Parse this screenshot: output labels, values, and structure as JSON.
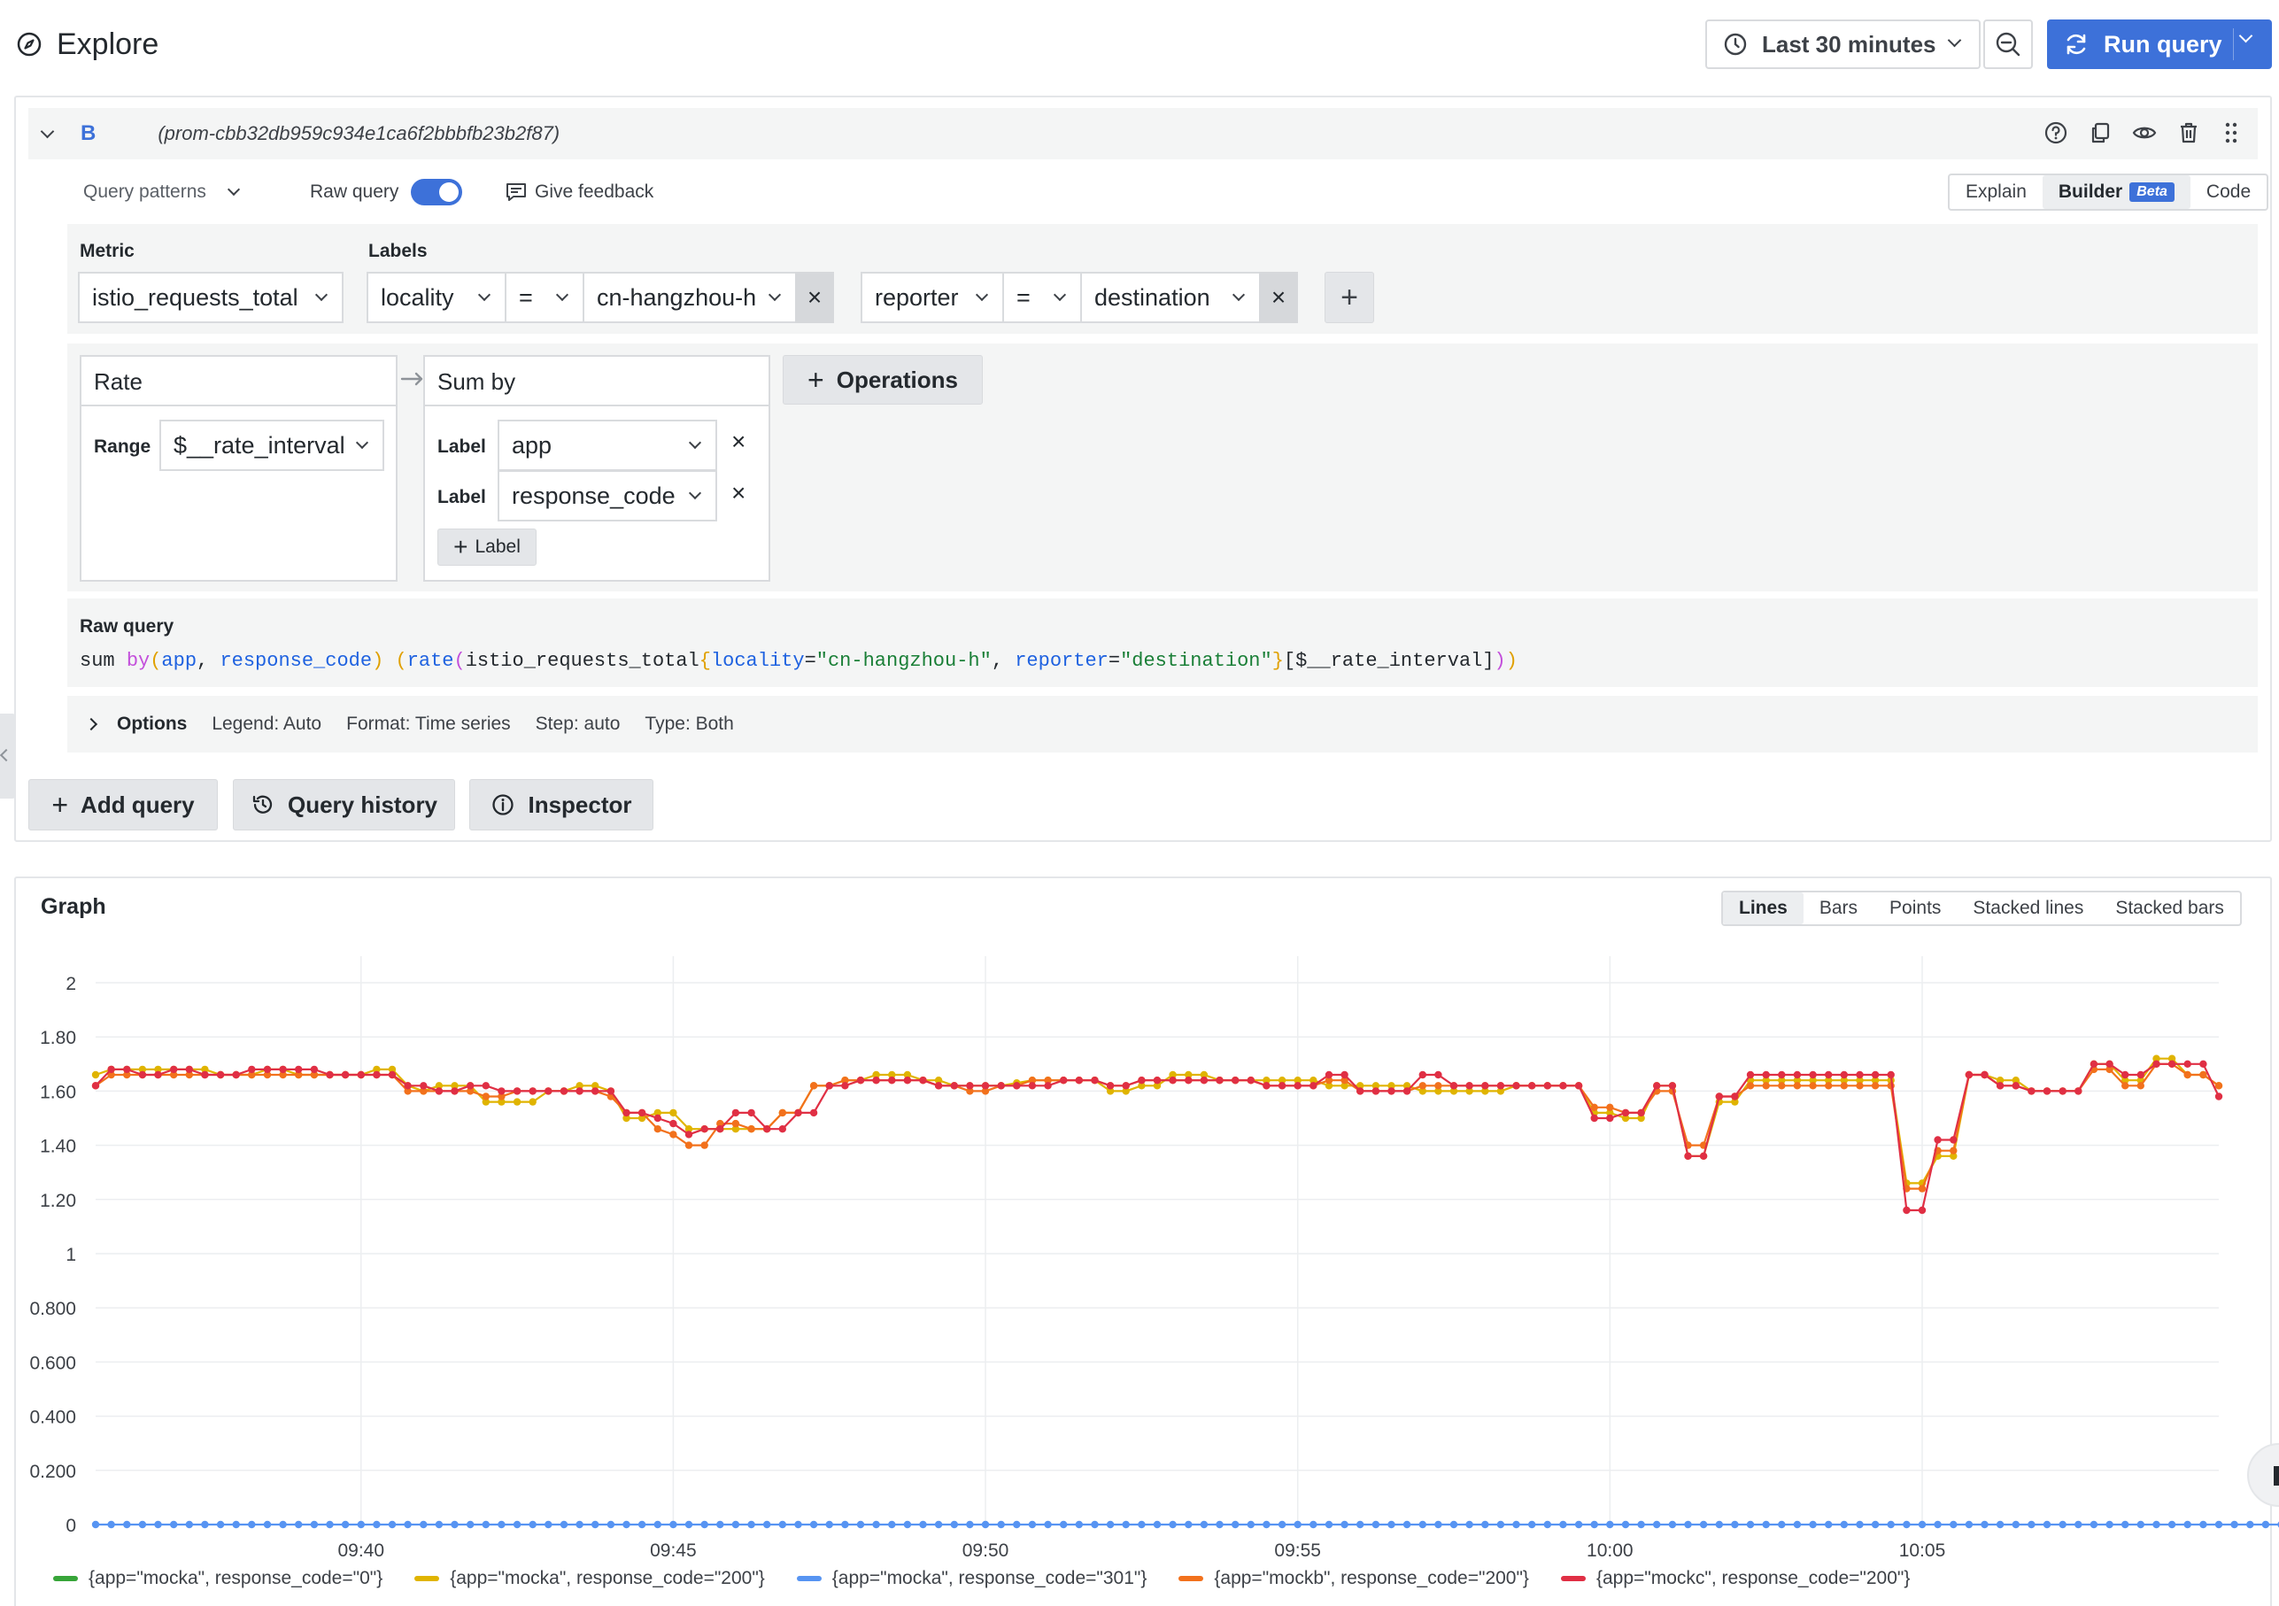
{
  "header": {
    "title": "Explore",
    "time_range": "Last 30 minutes",
    "run_query_label": "Run query"
  },
  "query": {
    "letter": "B",
    "datasource_id": "(prom-cbb32db959c934e1ca6f2bbbfb23b2f87)",
    "patterns_label": "Query patterns",
    "raw_query_toggle_label": "Raw query",
    "raw_query_toggle_on": true,
    "feedback_label": "Give feedback",
    "modes": [
      "Explain",
      "Builder",
      "Code"
    ],
    "active_mode": "Builder",
    "beta_badge": "Beta",
    "metric_label": "Metric",
    "metric_value": "istio_requests_total",
    "labels_label": "Labels",
    "label_filters": [
      {
        "key": "locality",
        "op": "=",
        "value": "cn-hangzhou-h"
      },
      {
        "key": "reporter",
        "op": "=",
        "value": "destination"
      }
    ],
    "ops": {
      "rate_title": "Rate",
      "range_label": "Range",
      "range_value": "$__rate_interval",
      "sumby_title": "Sum by",
      "label_word": "Label",
      "sumby_labels": [
        "app",
        "response_code"
      ],
      "add_label": "Label",
      "operations_button": "Operations"
    },
    "raw": {
      "title": "Raw query",
      "tokens": [
        {
          "t": "sum ",
          "c": "#24292e"
        },
        {
          "t": "by",
          "c": "#c34fdb"
        },
        {
          "t": "(",
          "c": "#e0a000"
        },
        {
          "t": "app",
          "c": "#1f62e0"
        },
        {
          "t": ", ",
          "c": "#24292e"
        },
        {
          "t": "response_code",
          "c": "#1f62e0"
        },
        {
          "t": ") ",
          "c": "#e0a000"
        },
        {
          "t": "(",
          "c": "#e0a000"
        },
        {
          "t": "rate",
          "c": "#1f62e0"
        },
        {
          "t": "(",
          "c": "#c34fdb"
        },
        {
          "t": "istio_requests_total",
          "c": "#24292e"
        },
        {
          "t": "{",
          "c": "#e0a000"
        },
        {
          "t": "locality",
          "c": "#1f62e0"
        },
        {
          "t": "=",
          "c": "#24292e"
        },
        {
          "t": "\"cn-hangzhou-h\"",
          "c": "#1a7f37"
        },
        {
          "t": ", ",
          "c": "#24292e"
        },
        {
          "t": "reporter",
          "c": "#1f62e0"
        },
        {
          "t": "=",
          "c": "#24292e"
        },
        {
          "t": "\"destination\"",
          "c": "#1a7f37"
        },
        {
          "t": "}",
          "c": "#e0a000"
        },
        {
          "t": "[$__rate_interval]",
          "c": "#24292e"
        },
        {
          "t": ")",
          "c": "#c34fdb"
        },
        {
          "t": ")",
          "c": "#e0a000"
        }
      ]
    },
    "options": {
      "label": "Options",
      "legend": "Legend: Auto",
      "format": "Format: Time series",
      "step": "Step: auto",
      "type": "Type: Both"
    }
  },
  "actions": {
    "add_query": "Add query",
    "query_history": "Query history",
    "inspector": "Inspector"
  },
  "graph": {
    "title": "Graph",
    "view_modes": [
      "Lines",
      "Bars",
      "Points",
      "Stacked lines",
      "Stacked bars"
    ],
    "active_view": "Lines"
  },
  "chart_data": {
    "type": "line",
    "title": "Graph",
    "xlabel": "",
    "ylabel": "",
    "ylim": [
      0,
      2
    ],
    "y_ticks": [
      "2",
      "1.80",
      "1.60",
      "1.40",
      "1.20",
      "1",
      "0.800",
      "0.600",
      "0.400",
      "0.200",
      "0"
    ],
    "x_ticks": [
      "09:40",
      "09:45",
      "09:50",
      "09:55",
      "10:00",
      "10:05"
    ],
    "x_tick_minutes": [
      581,
      586,
      591,
      596,
      601,
      606
    ],
    "x_start_minute": 576.75,
    "x_step_minutes": 0.25,
    "grid": true,
    "legend_position": "bottom",
    "series": [
      {
        "name": "{app=\"mocka\", response_code=\"0\"}",
        "color": "#37a539",
        "values": []
      },
      {
        "name": "{app=\"mocka\", response_code=\"200\"}",
        "color": "#e0b400",
        "values": [
          1.66,
          1.68,
          1.68,
          1.68,
          1.68,
          1.68,
          1.68,
          1.68,
          1.66,
          1.66,
          1.66,
          1.68,
          1.68,
          1.66,
          1.66,
          1.66,
          1.66,
          1.66,
          1.68,
          1.68,
          1.62,
          1.6,
          1.62,
          1.62,
          1.62,
          1.56,
          1.56,
          1.56,
          1.56,
          1.6,
          1.6,
          1.62,
          1.62,
          1.6,
          1.5,
          1.5,
          1.52,
          1.52,
          1.46,
          1.46,
          1.46,
          1.46,
          1.46,
          1.46,
          1.52,
          1.52,
          1.62,
          1.62,
          1.64,
          1.64,
          1.66,
          1.66,
          1.66,
          1.64,
          1.64,
          1.62,
          1.62,
          1.62,
          1.62,
          1.63,
          1.64,
          1.64,
          1.64,
          1.64,
          1.64,
          1.6,
          1.6,
          1.62,
          1.62,
          1.66,
          1.66,
          1.66,
          1.64,
          1.64,
          1.64,
          1.64,
          1.64,
          1.64,
          1.64,
          1.62,
          1.62,
          1.62,
          1.62,
          1.62,
          1.62,
          1.6,
          1.6,
          1.6,
          1.6,
          1.6,
          1.6,
          1.62,
          1.62,
          1.62,
          1.62,
          1.62,
          1.52,
          1.52,
          1.5,
          1.5,
          1.62,
          1.62,
          1.36,
          1.36,
          1.56,
          1.56,
          1.64,
          1.64,
          1.64,
          1.64,
          1.64,
          1.64,
          1.64,
          1.64,
          1.64,
          1.64,
          1.26,
          1.26,
          1.36,
          1.36,
          1.66,
          1.66,
          1.64,
          1.64,
          1.6,
          1.6,
          1.6,
          1.6,
          1.7,
          1.7,
          1.64,
          1.64,
          1.72,
          1.72,
          1.66,
          1.66,
          1.62
        ]
      },
      {
        "name": "{app=\"mocka\", response_code=\"301\"}",
        "color": "#5794f2",
        "values": [
          0,
          0,
          0,
          0,
          0,
          0,
          0,
          0,
          0,
          0,
          0,
          0,
          0,
          0,
          0,
          0,
          0,
          0,
          0,
          0,
          0,
          0,
          0,
          0,
          0,
          0,
          0,
          0,
          0,
          0,
          0,
          0,
          0,
          0,
          0,
          0,
          0,
          0,
          0,
          0,
          0,
          0,
          0,
          0,
          0,
          0,
          0,
          0,
          0,
          0,
          0,
          0,
          0,
          0,
          0,
          0,
          0,
          0,
          0,
          0,
          0,
          0,
          0,
          0,
          0,
          0,
          0,
          0,
          0,
          0,
          0,
          0,
          0,
          0,
          0,
          0,
          0,
          0,
          0,
          0,
          0,
          0,
          0,
          0,
          0,
          0,
          0,
          0,
          0,
          0,
          0,
          0,
          0,
          0,
          0,
          0,
          0,
          0,
          0,
          0,
          0,
          0,
          0,
          0,
          0,
          0,
          0,
          0,
          0,
          0,
          0,
          0,
          0,
          0,
          0,
          0,
          0,
          0,
          0,
          0,
          0,
          0,
          0,
          0,
          0,
          0,
          0,
          0,
          0,
          0,
          0,
          0,
          0,
          0,
          0,
          0,
          0,
          0,
          0,
          0,
          0
        ]
      },
      {
        "name": "{app=\"mockb\", response_code=\"200\"}",
        "color": "#f2711c",
        "values": [
          1.62,
          1.66,
          1.66,
          1.66,
          1.66,
          1.66,
          1.66,
          1.66,
          1.66,
          1.66,
          1.66,
          1.66,
          1.66,
          1.66,
          1.66,
          1.66,
          1.66,
          1.66,
          1.66,
          1.66,
          1.6,
          1.6,
          1.6,
          1.6,
          1.6,
          1.58,
          1.58,
          1.6,
          1.6,
          1.6,
          1.6,
          1.6,
          1.6,
          1.58,
          1.52,
          1.52,
          1.46,
          1.44,
          1.4,
          1.4,
          1.48,
          1.48,
          1.46,
          1.46,
          1.52,
          1.52,
          1.62,
          1.62,
          1.64,
          1.64,
          1.64,
          1.64,
          1.64,
          1.64,
          1.62,
          1.62,
          1.6,
          1.6,
          1.62,
          1.62,
          1.64,
          1.64,
          1.64,
          1.64,
          1.64,
          1.62,
          1.62,
          1.64,
          1.64,
          1.64,
          1.64,
          1.64,
          1.64,
          1.64,
          1.64,
          1.62,
          1.62,
          1.62,
          1.62,
          1.64,
          1.64,
          1.6,
          1.6,
          1.6,
          1.6,
          1.62,
          1.62,
          1.62,
          1.62,
          1.62,
          1.62,
          1.62,
          1.62,
          1.62,
          1.62,
          1.62,
          1.54,
          1.54,
          1.52,
          1.52,
          1.6,
          1.6,
          1.4,
          1.4,
          1.58,
          1.58,
          1.62,
          1.62,
          1.62,
          1.62,
          1.62,
          1.62,
          1.62,
          1.62,
          1.62,
          1.62,
          1.24,
          1.24,
          1.38,
          1.38,
          1.66,
          1.66,
          1.62,
          1.62,
          1.6,
          1.6,
          1.6,
          1.6,
          1.68,
          1.68,
          1.62,
          1.62,
          1.7,
          1.7,
          1.66,
          1.66,
          1.62
        ]
      },
      {
        "name": "{app=\"mockc\", response_code=\"200\"}",
        "color": "#e02f44",
        "values": [
          1.62,
          1.68,
          1.68,
          1.66,
          1.66,
          1.68,
          1.68,
          1.66,
          1.66,
          1.66,
          1.68,
          1.68,
          1.68,
          1.68,
          1.68,
          1.66,
          1.66,
          1.66,
          1.66,
          1.66,
          1.62,
          1.62,
          1.6,
          1.6,
          1.62,
          1.62,
          1.6,
          1.6,
          1.6,
          1.6,
          1.6,
          1.6,
          1.6,
          1.6,
          1.52,
          1.52,
          1.5,
          1.48,
          1.44,
          1.46,
          1.46,
          1.52,
          1.52,
          1.46,
          1.46,
          1.52,
          1.52,
          1.62,
          1.62,
          1.64,
          1.64,
          1.64,
          1.64,
          1.64,
          1.62,
          1.62,
          1.62,
          1.62,
          1.62,
          1.62,
          1.62,
          1.62,
          1.64,
          1.64,
          1.64,
          1.62,
          1.62,
          1.64,
          1.64,
          1.64,
          1.64,
          1.64,
          1.64,
          1.64,
          1.64,
          1.62,
          1.62,
          1.62,
          1.62,
          1.66,
          1.66,
          1.6,
          1.6,
          1.6,
          1.6,
          1.66,
          1.66,
          1.62,
          1.62,
          1.62,
          1.62,
          1.62,
          1.62,
          1.62,
          1.62,
          1.62,
          1.5,
          1.5,
          1.52,
          1.52,
          1.62,
          1.62,
          1.36,
          1.36,
          1.58,
          1.58,
          1.66,
          1.66,
          1.66,
          1.66,
          1.66,
          1.66,
          1.66,
          1.66,
          1.66,
          1.66,
          1.16,
          1.16,
          1.42,
          1.42,
          1.66,
          1.66,
          1.62,
          1.62,
          1.6,
          1.6,
          1.6,
          1.6,
          1.7,
          1.7,
          1.66,
          1.66,
          1.7,
          1.7,
          1.7,
          1.7,
          1.58
        ]
      }
    ]
  }
}
